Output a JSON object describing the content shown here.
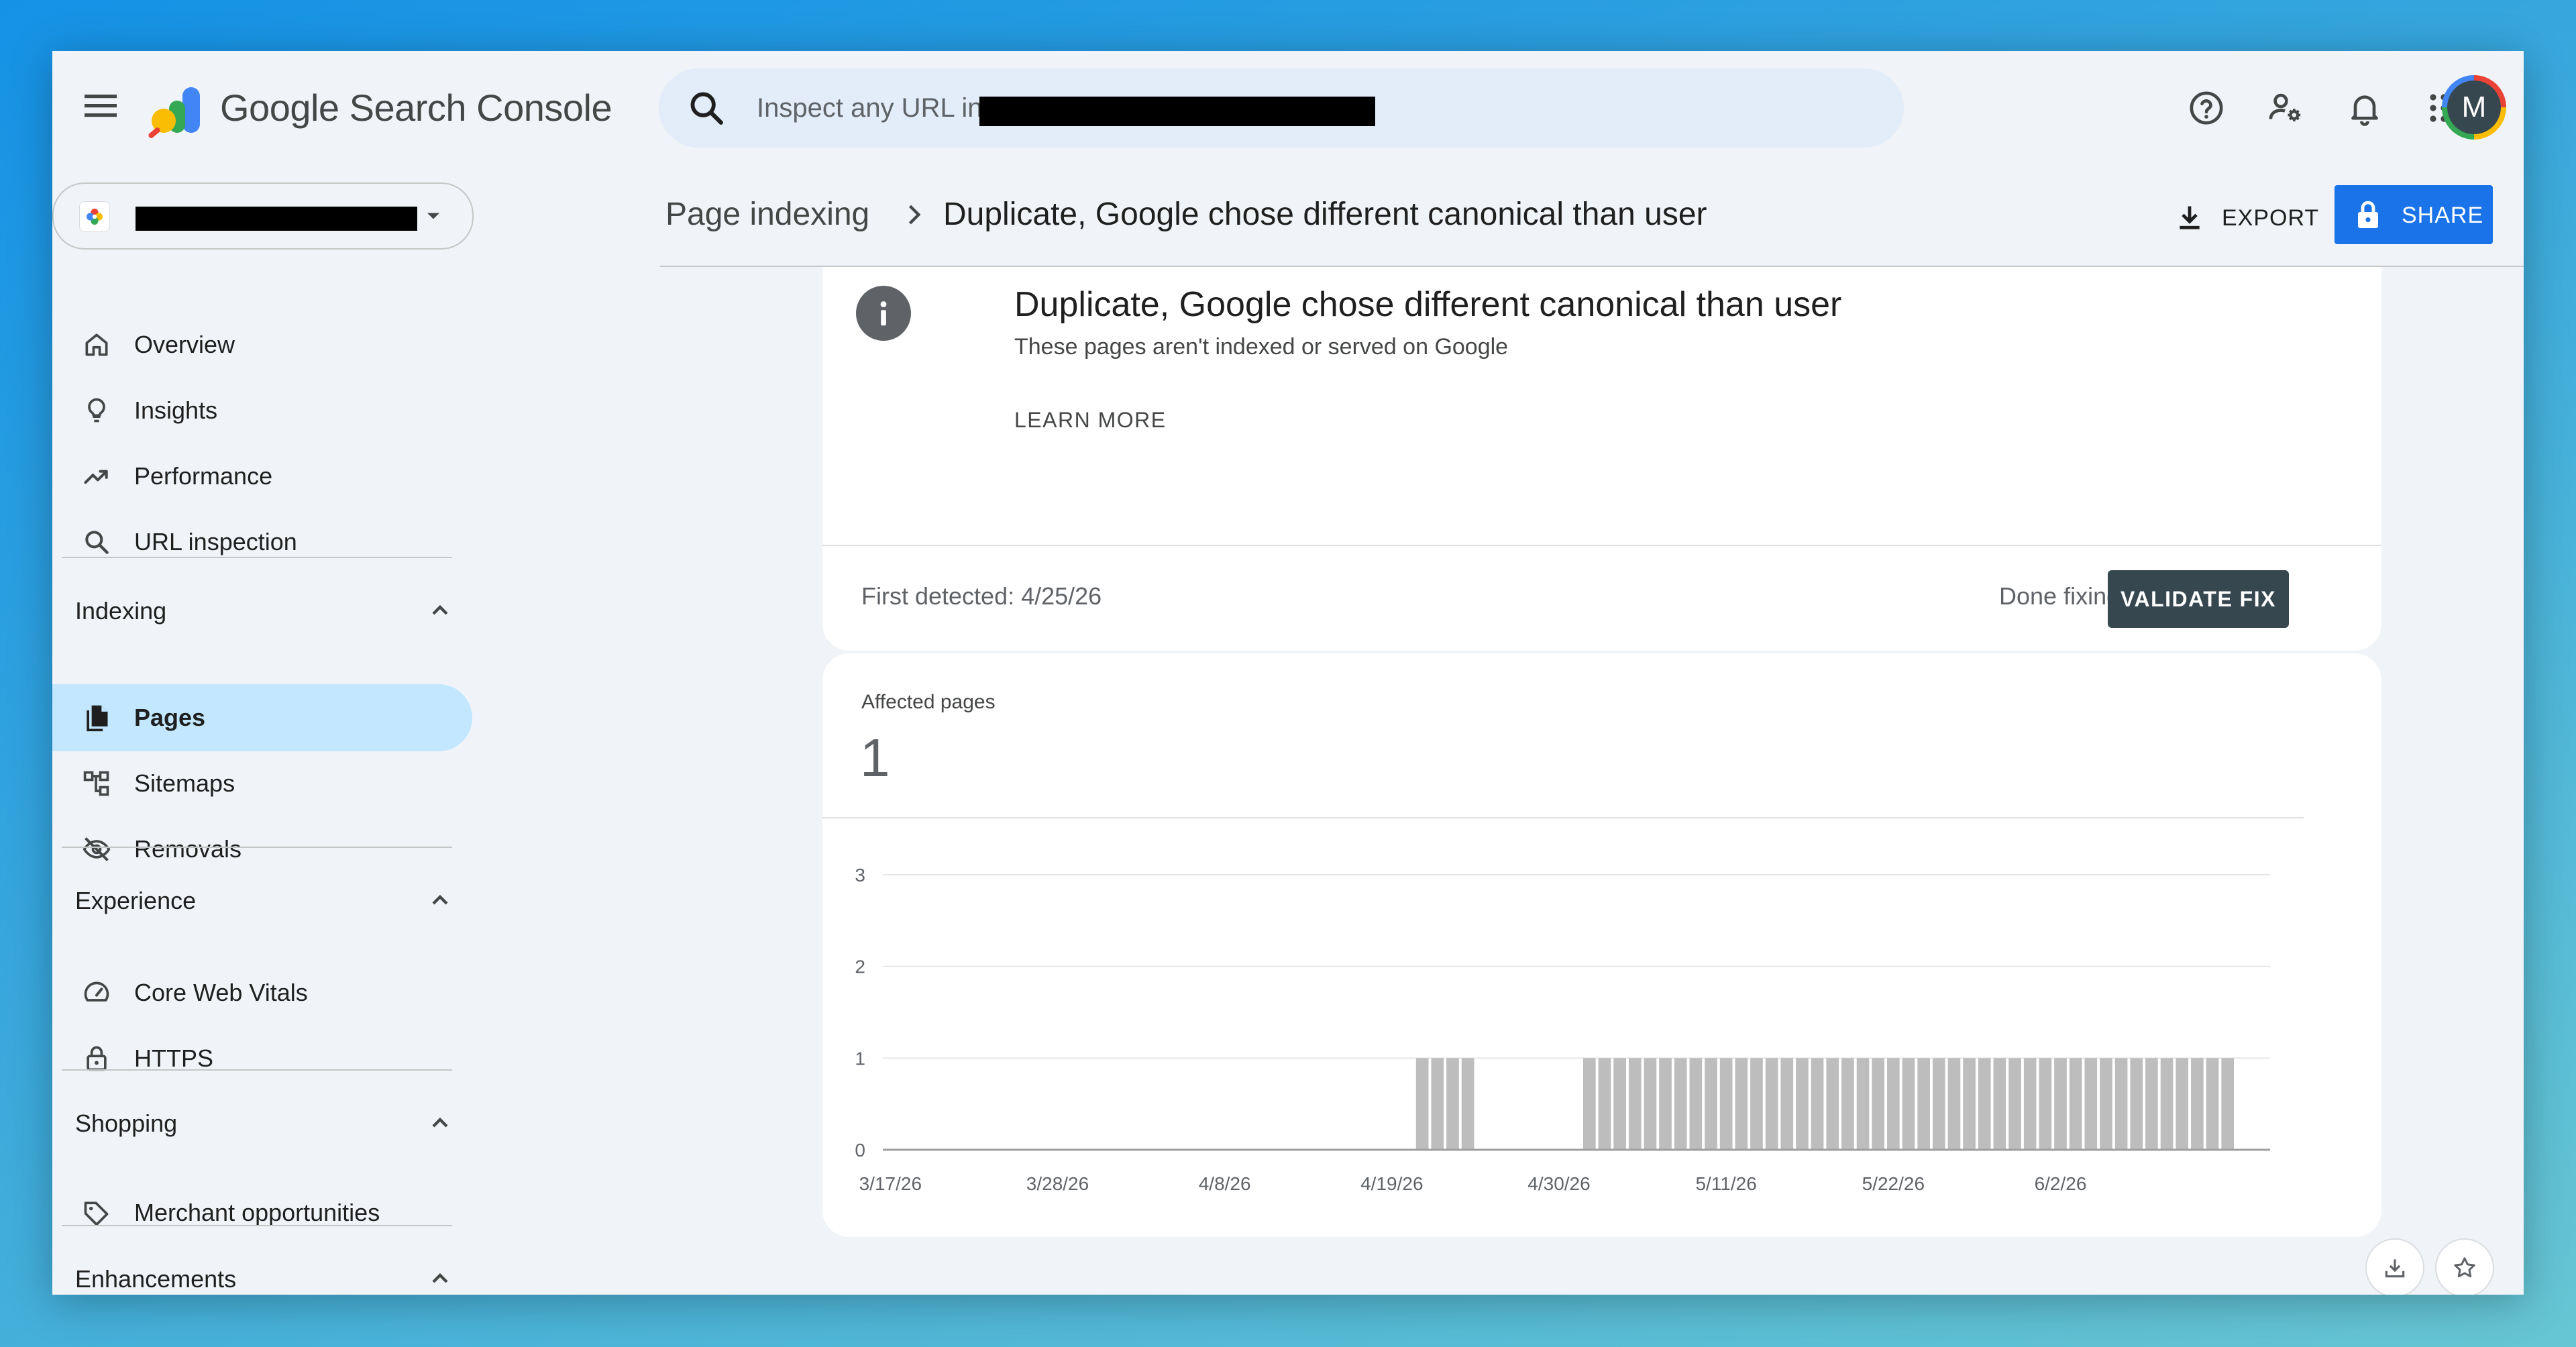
{
  "app": {
    "product_name": "Google Search Console",
    "search_placeholder": "Inspect any URL in"
  },
  "header": {
    "breadcrumb_parent": "Page indexing",
    "breadcrumb_current": "Duplicate, Google chose different canonical than user",
    "export_label": "EXPORT",
    "share_label": "SHARE"
  },
  "user": {
    "avatar_letter": "M"
  },
  "sidebar": {
    "top_items": [
      {
        "label": "Overview",
        "icon": "home-icon"
      },
      {
        "label": "Insights",
        "icon": "lightbulb-icon"
      },
      {
        "label": "Performance",
        "icon": "trending-up-icon"
      },
      {
        "label": "URL inspection",
        "icon": "search-icon"
      }
    ],
    "sections": [
      {
        "title": "Indexing",
        "items": [
          {
            "label": "Pages",
            "icon": "pages-icon",
            "active": true
          },
          {
            "label": "Sitemaps",
            "icon": "sitemap-icon"
          },
          {
            "label": "Removals",
            "icon": "eye-off-icon"
          }
        ]
      },
      {
        "title": "Experience",
        "items": [
          {
            "label": "Core Web Vitals",
            "icon": "speedometer-icon"
          },
          {
            "label": "HTTPS",
            "icon": "lock-icon"
          }
        ]
      },
      {
        "title": "Shopping",
        "items": [
          {
            "label": "Merchant opportunities",
            "icon": "tag-icon"
          }
        ]
      },
      {
        "title": "Enhancements",
        "items": []
      }
    ]
  },
  "issue": {
    "title": "Duplicate, Google chose different canonical than user",
    "subtitle": "These pages aren't indexed or served on Google",
    "learn_more": "LEARN MORE",
    "first_detected": "First detected: 4/25/26",
    "done_fixing": "Done fixing?",
    "validate_label": "VALIDATE FIX"
  },
  "affected": {
    "label": "Affected pages",
    "value": "1"
  },
  "chart_data": {
    "type": "bar",
    "ylim": [
      0,
      3
    ],
    "yticks": [
      "0",
      "1",
      "2",
      "3"
    ],
    "x_tick_labels": [
      "3/17/26",
      "3/28/26",
      "4/8/26",
      "4/19/26",
      "4/30/26",
      "5/11/26",
      "5/22/26",
      "6/2/26"
    ],
    "start_date": "3/17/26",
    "series": [
      {
        "values": [
          0,
          0,
          0,
          0,
          0,
          0,
          0,
          0,
          0,
          0,
          0,
          0,
          0,
          0,
          0,
          0,
          0,
          0,
          0,
          0,
          0,
          0,
          0,
          0,
          0,
          0,
          0,
          0,
          0,
          0,
          0,
          0,
          0,
          0,
          0,
          1,
          1,
          1,
          1,
          0,
          0,
          0,
          0,
          0,
          0,
          0,
          1,
          1,
          1,
          1,
          1,
          1,
          1,
          1,
          1,
          1,
          1,
          1,
          1,
          1,
          1,
          1,
          1,
          1,
          1,
          1,
          1,
          1,
          1,
          1,
          1,
          1,
          1,
          1,
          1,
          1,
          1,
          1,
          1,
          1,
          1,
          1,
          1,
          1,
          1,
          1,
          1,
          1,
          1
        ]
      }
    ],
    "grid": true,
    "colors": {
      "bar": "#bdbdbd",
      "grid": "#e6e6e6",
      "axis": "#9e9e9e"
    }
  }
}
